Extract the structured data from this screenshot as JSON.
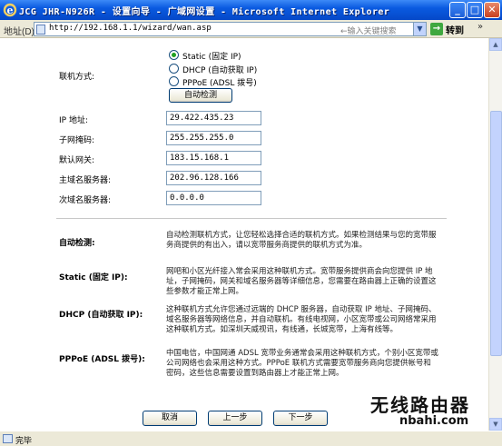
{
  "window": {
    "title": "JCG JHR-N926R - 设置向导 - 广域网设置 - Microsoft Internet Explorer",
    "minimize": "_",
    "maximize": "□",
    "close": "✕"
  },
  "addressbar": {
    "label": "地址(D)",
    "url": "http://192.168.1.1/wizard/wan.asp",
    "search_hint": "←输入关键搜索",
    "go_label": "转到"
  },
  "form": {
    "connection_label": "联机方式:",
    "modes": [
      {
        "label": "Static (固定 IP)",
        "selected": true
      },
      {
        "label": "DHCP (自动获取 IP)",
        "selected": false
      },
      {
        "label": "PPPoE (ADSL 拨号)",
        "selected": false
      }
    ],
    "autodetect_button": "自动检测",
    "fields": [
      {
        "label": "IP 地址:",
        "value": "29.422.435.23"
      },
      {
        "label": "子网掩码:",
        "value": "255.255.255.0"
      },
      {
        "label": "默认网关:",
        "value": "183.15.168.1"
      },
      {
        "label": "主域名服务器:",
        "value": "202.96.128.166"
      },
      {
        "label": "次域名服务器:",
        "value": "0.0.0.0"
      }
    ]
  },
  "help": [
    {
      "term": "自动检测:",
      "text": "自动检测联机方式，让您轻松选择合适的联机方式。如果检测结果与您的宽带服务商提供的有出入，请以宽带服务商提供的联机方式为准。"
    },
    {
      "term": "Static (固定 IP):",
      "text": "网吧和小区光纤接入常会采用这种联机方式。宽带服务提供商会向您提供 IP 地址，子网掩码，网关和域名服务器等详细信息，您需要在路由器上正确的设置这些参数才能正常上网。"
    },
    {
      "term": "DHCP (自动获取 IP):",
      "text": "这种联机方式允许您通过远端的 DHCP 服务器，自动获取 IP 地址、子网掩码、域名服务器等网络信息，并自动联机。有线电视网，小区宽带或公司网络常采用这种联机方式。如深圳天威视讯，有线通，长城宽带，上海有线等。"
    },
    {
      "term": "PPPoE (ADSL 拨号):",
      "text": "中国电信，中国网通 ADSL 宽带业务通常会采用这种联机方式，个别小区宽带或公司网络也会采用这种方式。PPPoE 联机方式需要宽带服务商向您提供帐号和密码，这些信息需要设置到路由器上才能正常上网。"
    }
  ],
  "buttons": {
    "cancel": "取消",
    "prev": "上一步",
    "next": "下一步"
  },
  "statusbar": {
    "text": "完毕"
  },
  "watermark": {
    "cn": "无线路由器",
    "en": "nbahi.com"
  }
}
